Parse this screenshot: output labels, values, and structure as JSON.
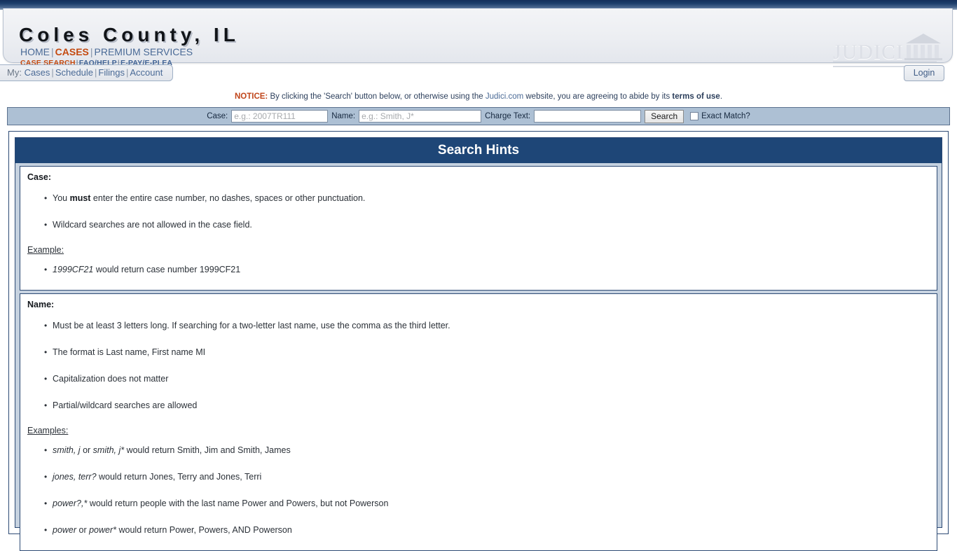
{
  "header": {
    "county_title": "Coles County, IL",
    "primary_nav": [
      {
        "label": "HOME",
        "active": false
      },
      {
        "label": "CASES",
        "active": true
      },
      {
        "label": "PREMIUM SERVICES",
        "active": false
      }
    ],
    "secondary_nav": [
      {
        "label": "CASE SEARCH",
        "active": true
      },
      {
        "label": "FAQ/HELP",
        "active": false
      },
      {
        "label": "E-PAY/E-PLEA",
        "active": false
      }
    ],
    "logo_text": "JUDICI",
    "login_label": "Login"
  },
  "my_tab": {
    "prefix": "My:",
    "items": [
      {
        "label": "Cases"
      },
      {
        "label": "Schedule"
      },
      {
        "label": "Filings"
      },
      {
        "label": "Account"
      }
    ]
  },
  "notice": {
    "label": "NOTICE:",
    "text_before_site": " By clicking the 'Search' button below, or otherwise using the ",
    "site_link": "Judici.com",
    "text_after_site": " website, you are agreeing to abide by its ",
    "terms_link": "terms of use",
    "period": "."
  },
  "search_bar": {
    "case_label": "Case:",
    "case_placeholder": "e.g.: 2007TR111",
    "case_value": "",
    "name_label": "Name:",
    "name_placeholder": "e.g.: Smith, J*",
    "name_value": "",
    "charge_label": "Charge Text:",
    "charge_placeholder": "",
    "charge_value": "",
    "search_button": "Search",
    "exact_match_label": "Exact Match?",
    "exact_match_checked": false
  },
  "hints": {
    "title": "Search Hints",
    "sections": [
      {
        "heading": "Case:",
        "bullets": [
          {
            "parts": [
              {
                "t": "You ",
                "s": "n"
              },
              {
                "t": "must",
                "s": "b"
              },
              {
                "t": " enter the entire case number, no dashes, spaces or other punctuation.",
                "s": "n"
              }
            ]
          },
          {
            "parts": [
              {
                "t": "Wildcard searches are not allowed in the case field.",
                "s": "n"
              }
            ]
          }
        ],
        "sub_heading": "Example:",
        "sub_bullets": [
          {
            "parts": [
              {
                "t": "1999CF21",
                "s": "i"
              },
              {
                "t": " would return case number 1999CF21",
                "s": "n"
              }
            ]
          }
        ]
      },
      {
        "heading": "Name:",
        "bullets": [
          {
            "parts": [
              {
                "t": "Must be at least 3 letters long. If searching for a two-letter last name, use the comma as the third letter.",
                "s": "n"
              }
            ]
          },
          {
            "parts": [
              {
                "t": "The format is Last name, First name MI",
                "s": "n"
              }
            ]
          },
          {
            "parts": [
              {
                "t": "Capitalization does not matter",
                "s": "n"
              }
            ]
          },
          {
            "parts": [
              {
                "t": "Partial/wildcard searches are allowed",
                "s": "n"
              }
            ]
          }
        ],
        "sub_heading": "Examples:",
        "sub_bullets": [
          {
            "parts": [
              {
                "t": "smith, j",
                "s": "i"
              },
              {
                "t": " or ",
                "s": "n"
              },
              {
                "t": "smith, j*",
                "s": "i"
              },
              {
                "t": " would return Smith, Jim and Smith, James",
                "s": "n"
              }
            ]
          },
          {
            "parts": [
              {
                "t": "jones, terr?",
                "s": "i"
              },
              {
                "t": " would return Jones, Terry and Jones, Terri",
                "s": "n"
              }
            ]
          },
          {
            "parts": [
              {
                "t": "power?,*",
                "s": "i"
              },
              {
                "t": " would return people with the last name Power and Powers, but not Powerson",
                "s": "n"
              }
            ]
          },
          {
            "parts": [
              {
                "t": "power",
                "s": "i"
              },
              {
                "t": " or ",
                "s": "n"
              },
              {
                "t": "power*",
                "s": "i"
              },
              {
                "t": " would return Power, Powers, AND Powerson",
                "s": "n"
              }
            ]
          }
        ]
      }
    ]
  },
  "colors": {
    "navy": "#1e4677",
    "accent_orange": "#c44a10",
    "link_blue": "#4a6a96",
    "searchbar_blue": "#adc0d4"
  }
}
